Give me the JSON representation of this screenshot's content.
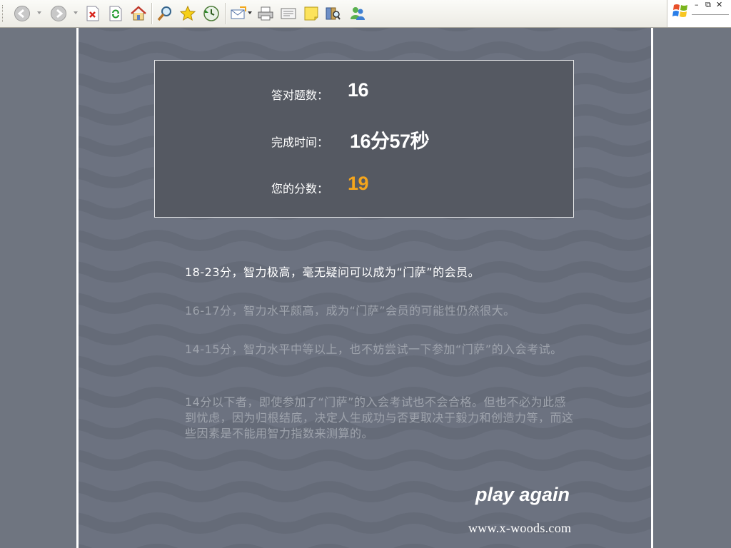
{
  "toolbar": {
    "buttons": [
      "back",
      "forward",
      "stop",
      "refresh",
      "home",
      "search",
      "favorites",
      "history",
      "mail",
      "print",
      "edit",
      "discuss",
      "research",
      "messenger"
    ]
  },
  "window_controls": {
    "minimize": "–",
    "restore": "⧉",
    "close": "✕"
  },
  "result": {
    "correct_label": "答对题数：",
    "correct_value": "16",
    "time_label": "完成时间：",
    "time_value": "16分57秒",
    "score_label": "您的分数：",
    "score_value": "19"
  },
  "tiers": [
    {
      "text": "18-23分，智力极高，毫无疑问可以成为“门萨”的会员。"
    },
    {
      "text": "16-17分，智力水平颇高，成为“门萨”会员的可能性仍然很大。"
    },
    {
      "text": "14-15分，智力水平中等以上，也不妨尝试一下参加“门萨”的入会考试。"
    },
    {
      "text": "14分以下者，即使参加了“门萨”的入会考试也不会合格。但也不必为此感到忧虑，因为归根结底，决定人生成功与否更取决于毅力和创造力等，而这些因素是不能用智力指数来测算的。"
    }
  ],
  "footer": {
    "play_again": "play again",
    "site": "www.x-woods.com"
  },
  "colors": {
    "background": "#6f7580",
    "score_box": "#555962",
    "accent_orange": "#f4a51c",
    "dim_text": "#9ea3ac"
  }
}
